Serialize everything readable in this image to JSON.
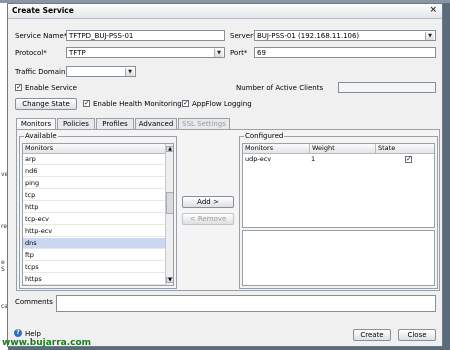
{
  "dialog": {
    "title": "Create Service"
  },
  "form": {
    "service_name_label": "Service Name*",
    "service_name_value": "TFTPD_BUJ-PSS-01",
    "server_label": "Server*",
    "server_value": "BUJ-PSS-01 (192.168.11.106)",
    "protocol_label": "Protocol*",
    "protocol_value": "TFTP",
    "port_label": "Port*",
    "port_value": "69",
    "traffic_domain_label": "Traffic Domain",
    "traffic_domain_value": "",
    "active_clients_label": "Number of Active Clients",
    "active_clients_value": "",
    "enable_service_label": "Enable Service",
    "enable_service_checked": true,
    "change_state_label": "Change State",
    "health_monitoring_label": "Enable Health Monitoring",
    "health_monitoring_checked": true,
    "appflow_label": "AppFlow Logging",
    "appflow_checked": true,
    "comments_label": "Comments",
    "comments_value": ""
  },
  "tabs": [
    {
      "label": "Monitors",
      "active": true,
      "disabled": false
    },
    {
      "label": "Policies",
      "active": false,
      "disabled": false
    },
    {
      "label": "Profiles",
      "active": false,
      "disabled": false
    },
    {
      "label": "Advanced",
      "active": false,
      "disabled": false
    },
    {
      "label": "SSL Settings",
      "active": false,
      "disabled": true
    }
  ],
  "available": {
    "group_label": "Available",
    "header": "Monitors",
    "items": [
      "arp",
      "nd6",
      "ping",
      "tcp",
      "http",
      "tcp-ecv",
      "http-ecv",
      "dns",
      "ftp",
      "tcps",
      "https"
    ],
    "selected_index": 7
  },
  "buttons": {
    "add": "Add >",
    "remove": "< Remove",
    "create": "Create",
    "close": "Close"
  },
  "configured": {
    "group_label": "Configured",
    "headers": [
      "Monitors",
      "Weight",
      "State"
    ],
    "rows": [
      {
        "monitor": "udp-ecv",
        "weight": "1",
        "state": true
      }
    ]
  },
  "footer": {
    "help_label": "Help"
  },
  "background": {
    "side_labels": [
      "ve",
      "re",
      "e S",
      "ca"
    ]
  },
  "watermark": "www.bujarra.com"
}
